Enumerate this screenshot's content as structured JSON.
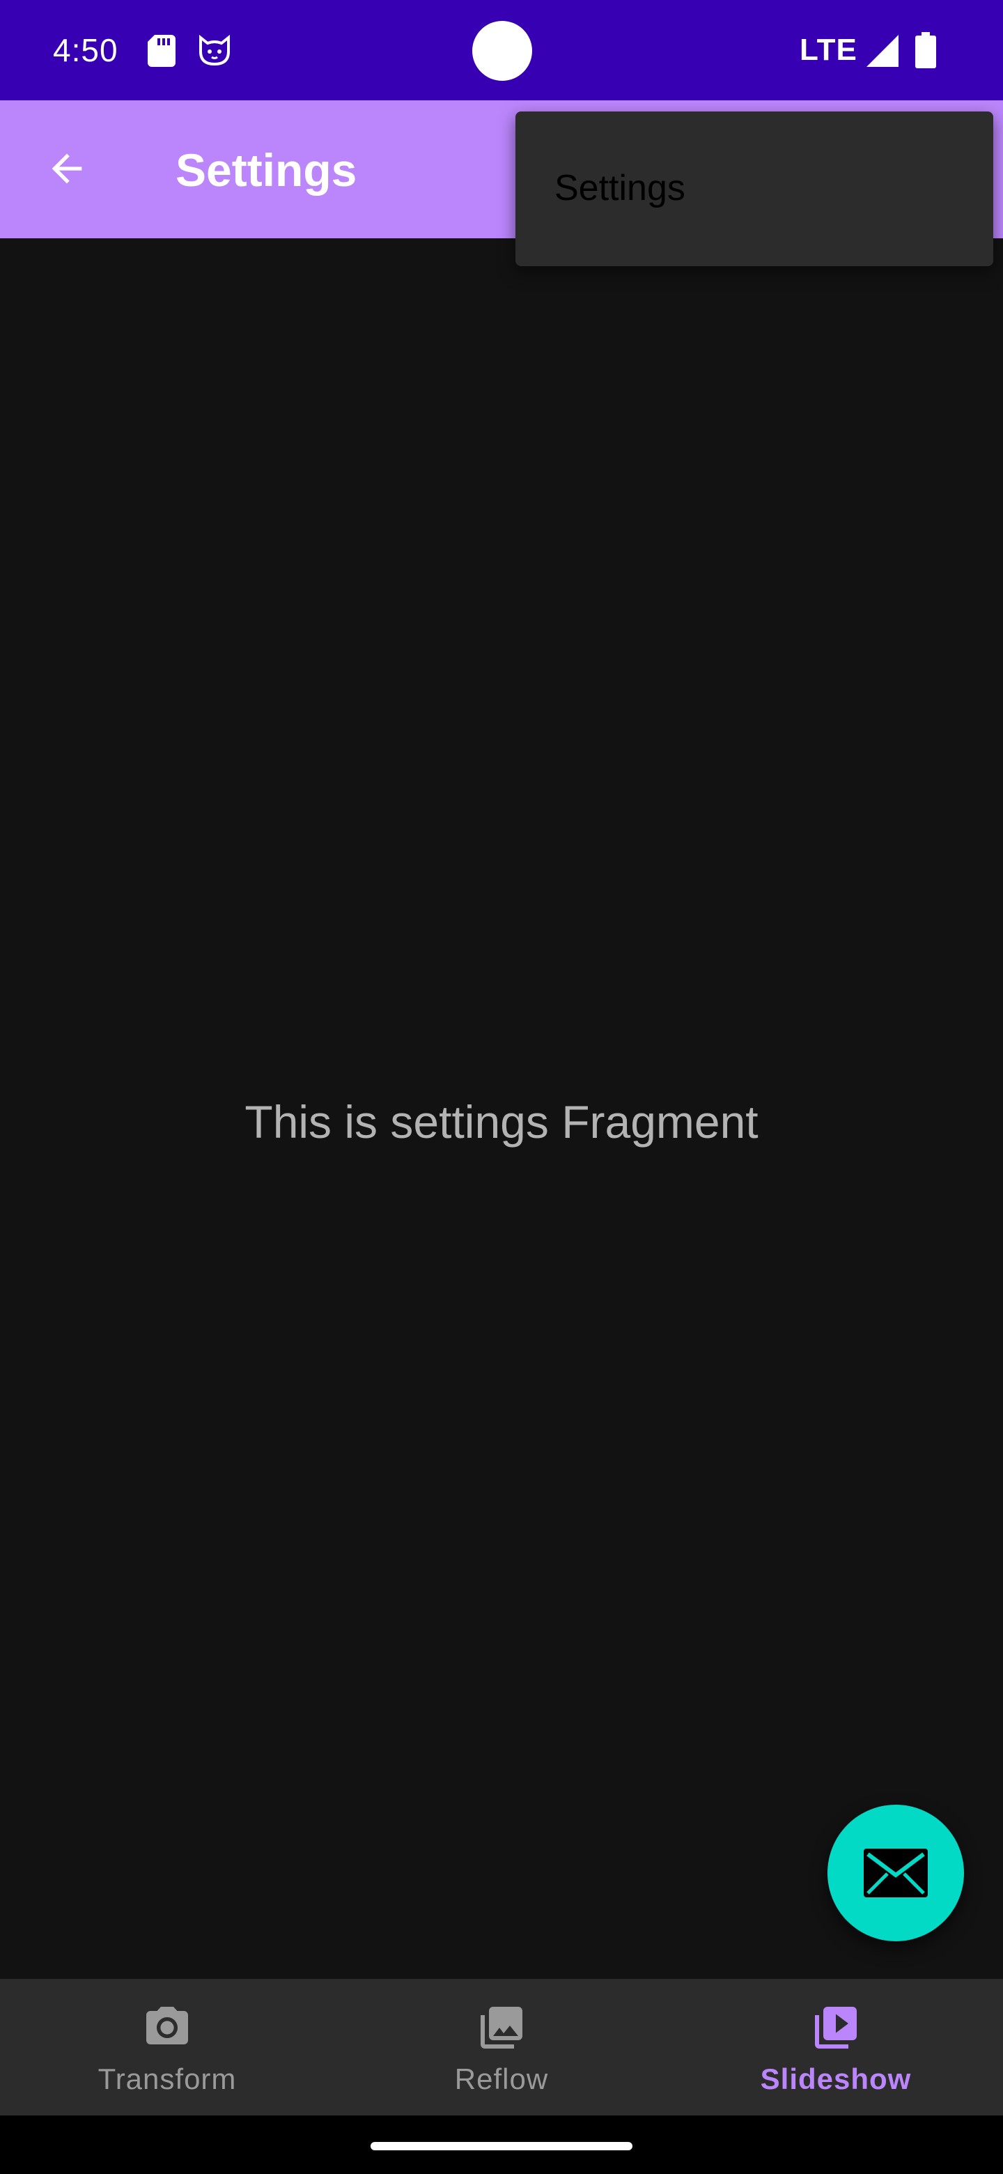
{
  "status_bar": {
    "time": "4:50",
    "network": "LTE",
    "icons": [
      "sd-card-icon",
      "cat-icon",
      "signal-icon",
      "battery-icon"
    ],
    "background_color": "#3700b3"
  },
  "app_bar": {
    "title": "Settings",
    "back_icon": "arrow-back-icon",
    "background_color": "#bb86fc"
  },
  "popup_menu": {
    "items": [
      {
        "label": "Settings"
      }
    ]
  },
  "main": {
    "message": "This is settings Fragment"
  },
  "fab": {
    "icon": "email-icon",
    "color": "#03dac5"
  },
  "bottom_nav": {
    "items": [
      {
        "label": "Transform",
        "icon": "camera-icon",
        "active": false
      },
      {
        "label": "Reflow",
        "icon": "photo-library-icon",
        "active": false
      },
      {
        "label": "Slideshow",
        "icon": "slideshow-icon",
        "active": true
      }
    ],
    "active_color": "#bb86fc",
    "inactive_color": "#9a9a9a"
  }
}
